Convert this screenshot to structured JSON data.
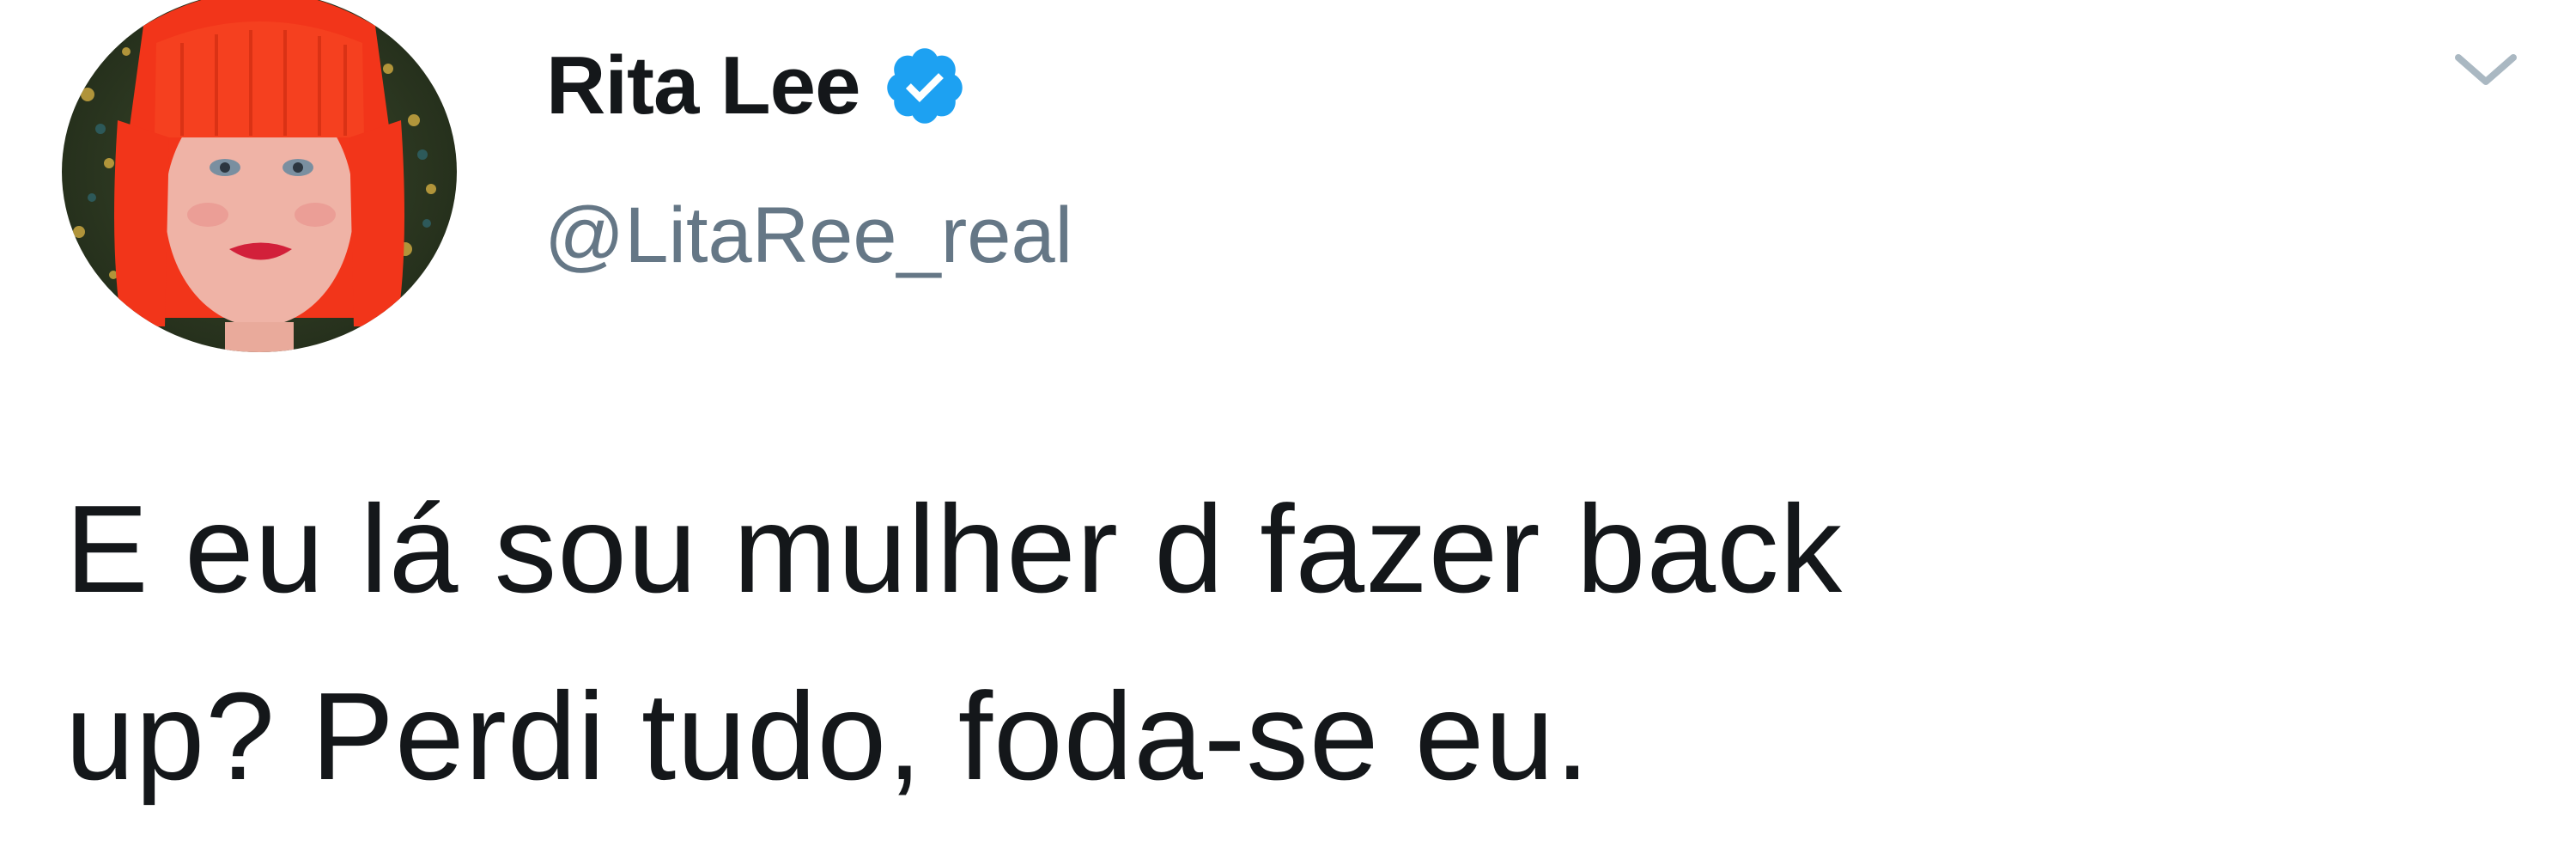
{
  "user": {
    "display_name": "Rita Lee",
    "handle": "@LitaRee_real",
    "verified": true,
    "avatar_icon": "profile-photo-red-hair"
  },
  "tweet": {
    "text_lines": [
      "E eu lá sou mulher d fazer back",
      "up? Perdi tudo, foda-se eu."
    ]
  },
  "menu": {
    "icon": "chevron-down-icon"
  },
  "colors": {
    "verified_badge": "#1da1f2",
    "handle_text": "#657786",
    "body_text": "#14171a",
    "caret": "#aab8c2",
    "hair": "#f2351a"
  }
}
